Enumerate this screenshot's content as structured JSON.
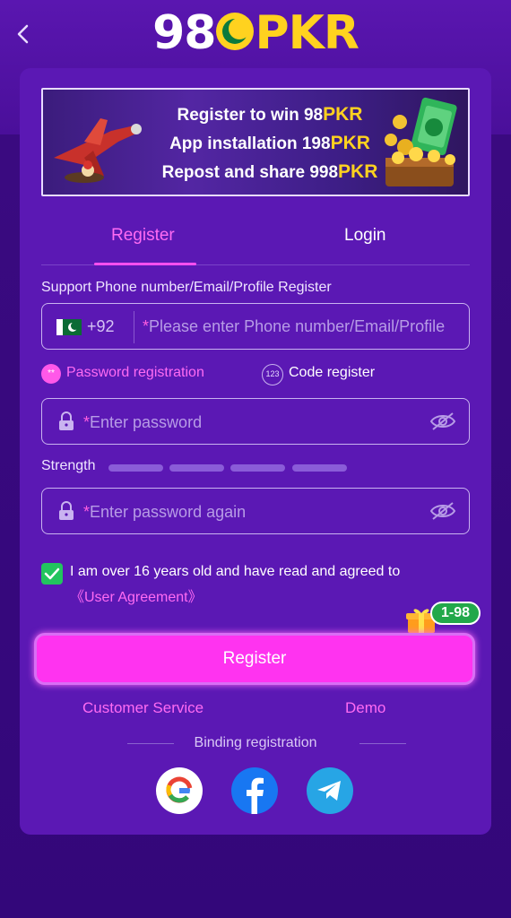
{
  "header": {
    "logo_part1": "98",
    "logo_part2": "PKR"
  },
  "banner": {
    "line1_text": "Register to win 98",
    "line1_amount": "PKR",
    "line2_text": "App installation 198",
    "line2_amount": "PKR",
    "line3_text": "Repost and share 998",
    "line3_amount": "PKR"
  },
  "tabs": [
    {
      "label": "Register",
      "active": true
    },
    {
      "label": "Login",
      "active": false
    }
  ],
  "form": {
    "support_label": "Support Phone number/Email/Profile Register",
    "country_code": "+92",
    "account_placeholder": "Please enter Phone number/Email/Profile",
    "required_mark": "*",
    "mode_password_icon": "**",
    "mode_password_label": "Password registration",
    "mode_code_icon": "123",
    "mode_code_label": "Code register",
    "password_placeholder": "Enter password",
    "strength_label": "Strength",
    "confirm_placeholder": "Enter password again",
    "agree_text": "I am over 16 years old and have read and agreed to",
    "agree_link": "《User Agreement》",
    "agree_checked": true,
    "gift_badge": "1-98",
    "register_button": "Register"
  },
  "footer": {
    "customer_service": "Customer Service",
    "demo": "Demo",
    "binding_label": "Binding registration",
    "social": [
      "google-icon",
      "facebook-icon",
      "telegram-icon"
    ]
  },
  "colors": {
    "accent": "#ff33f0",
    "accent_text": "#ff6bf3",
    "card_bg": "#5b18b4",
    "logo_yellow": "#ffd21f",
    "success": "#22c45e"
  }
}
